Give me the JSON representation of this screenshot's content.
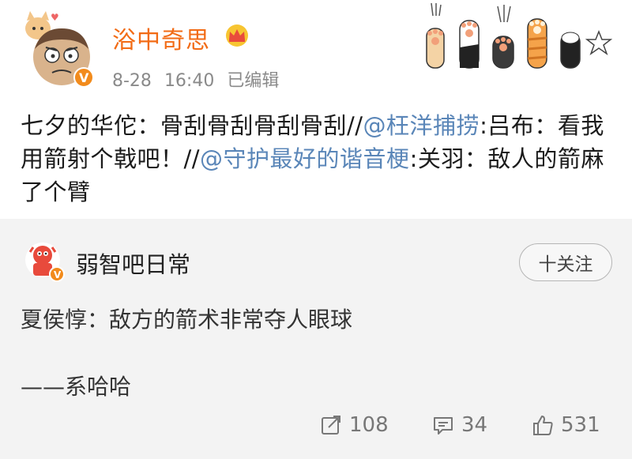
{
  "post": {
    "author": "浴中奇思",
    "date": "8-28",
    "time": "16:40",
    "edited_label": "已编辑",
    "text_part1": "七夕的华佗：骨刮骨刮骨刮骨刮//",
    "mention1": "@枉洋捕捞",
    "text_part2": ":吕布：看我用箭射个戟吧！//",
    "mention2": "@守护最好的谐音梗",
    "text_part3": ":关羽：敌人的箭麻了个臂"
  },
  "quoted": {
    "author": "弱智吧日常",
    "follow_label": "十关注",
    "line1": "夏侯惇：敌方的箭术非常夺人眼球",
    "line2": "——系哈哈"
  },
  "actions": {
    "repost_count": "108",
    "comment_count": "34",
    "like_count": "531"
  },
  "icons": {
    "avatar": "cartoon-face-with-cat-avatar",
    "verified": "orange-v-badge-icon",
    "crown": "crown-icon",
    "paws": "cat-paw-decorations",
    "repost": "share-icon",
    "comment": "comment-icon",
    "like": "thumbs-up-icon"
  },
  "colors": {
    "username": "#f26b15",
    "mention": "#5a86b8",
    "card_bg": "#f3f3f3",
    "meta": "#8a8a8a"
  }
}
